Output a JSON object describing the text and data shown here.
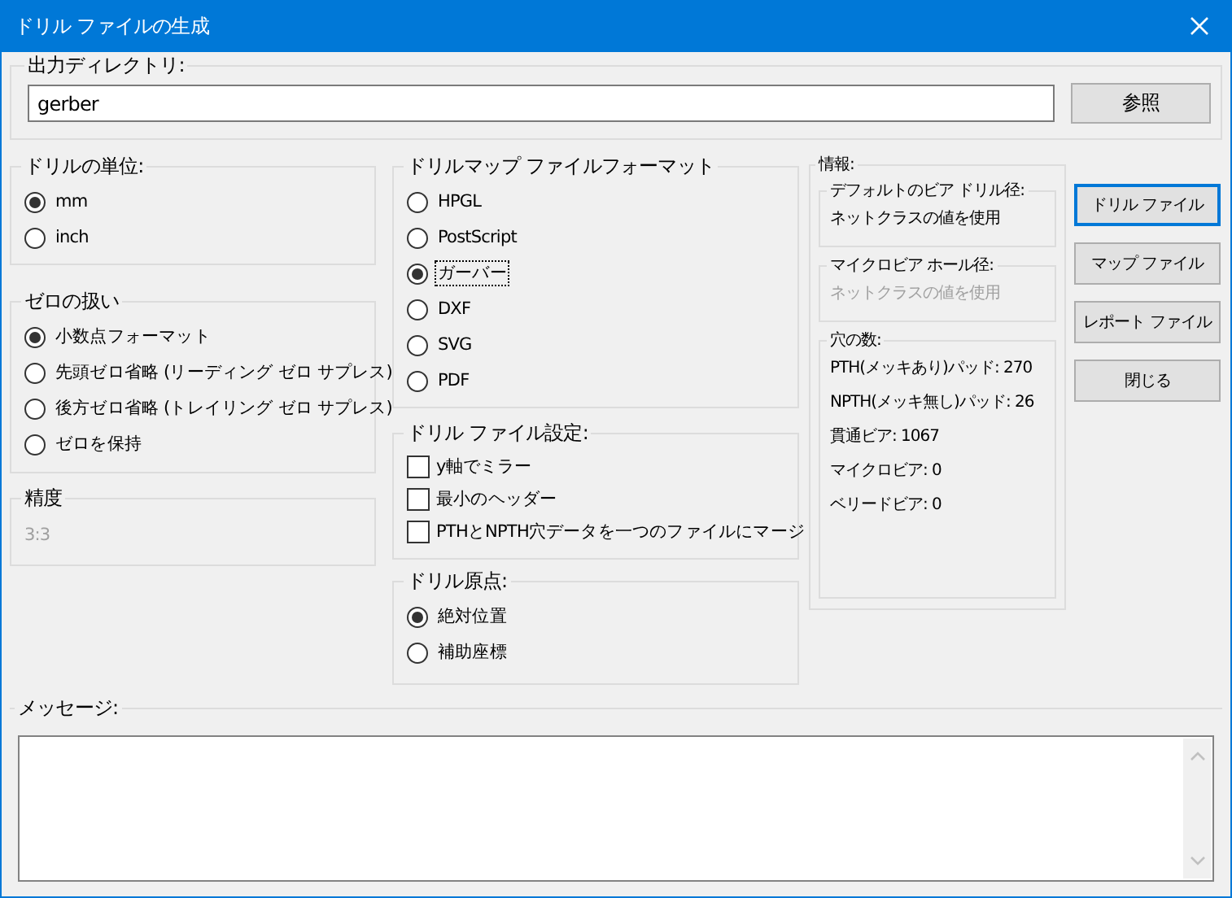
{
  "window": {
    "title": "ドリル ファイルの生成"
  },
  "output_directory": {
    "label": "出力ディレクトリ:",
    "value": "gerber",
    "browse_button": "参照"
  },
  "drill_units": {
    "label": "ドリルの単位:",
    "options": [
      {
        "label": "mm",
        "selected": true
      },
      {
        "label": "inch",
        "selected": false
      }
    ]
  },
  "zeros_format": {
    "label": "ゼロの扱い",
    "options": [
      {
        "label": "小数点フォーマット",
        "selected": true
      },
      {
        "label": "先頭ゼロ省略 (リーディング ゼロ サプレス)",
        "selected": false
      },
      {
        "label": "後方ゼロ省略 (トレイリング ゼロ サプレス)",
        "selected": false
      },
      {
        "label": "ゼロを保持",
        "selected": false
      }
    ]
  },
  "precision": {
    "label": "精度",
    "value": "3:3",
    "disabled": true
  },
  "map_format": {
    "label": "ドリルマップ ファイルフォーマット",
    "options": [
      {
        "label": "HPGL",
        "selected": false,
        "focused": false
      },
      {
        "label": "PostScript",
        "selected": false,
        "focused": false
      },
      {
        "label": "ガーバー",
        "selected": true,
        "focused": true
      },
      {
        "label": "DXF",
        "selected": false,
        "focused": false
      },
      {
        "label": "SVG",
        "selected": false,
        "focused": false
      },
      {
        "label": "PDF",
        "selected": false,
        "focused": false
      }
    ]
  },
  "drill_file_options": {
    "label": "ドリル ファイル設定:",
    "options": [
      {
        "label": "y軸でミラー",
        "checked": false
      },
      {
        "label": "最小のヘッダー",
        "checked": false
      },
      {
        "label": "PTHとNPTH穴データを一つのファイルにマージ",
        "checked": false
      }
    ]
  },
  "drill_origin": {
    "label": "ドリル原点:",
    "options": [
      {
        "label": "絶対位置",
        "selected": true
      },
      {
        "label": "補助座標",
        "selected": false
      }
    ]
  },
  "info": {
    "label": "情報:",
    "sections": [
      {
        "label": "デフォルトのビア ドリル径:",
        "disabled": false,
        "lines": [
          "ネットクラスの値を使用"
        ]
      },
      {
        "label": "マイクロビア ホール径:",
        "disabled": true,
        "lines": [
          "ネットクラスの値を使用"
        ]
      },
      {
        "label": "穴の数:",
        "disabled": false,
        "lines": [
          "PTH(メッキあり)パッド: 270",
          "NPTH(メッキ無し)パッド: 26",
          "貫通ビア: 1067",
          "マイクロビア: 0",
          "ベリードビア: 0"
        ]
      }
    ]
  },
  "buttons": [
    {
      "label": "ドリル ファイル",
      "default": true
    },
    {
      "label": "マップ ファイル",
      "default": false
    },
    {
      "label": "レポート ファイル",
      "default": false
    },
    {
      "label": "閉じる",
      "default": false
    }
  ],
  "messages": {
    "label": "メッセージ:"
  }
}
